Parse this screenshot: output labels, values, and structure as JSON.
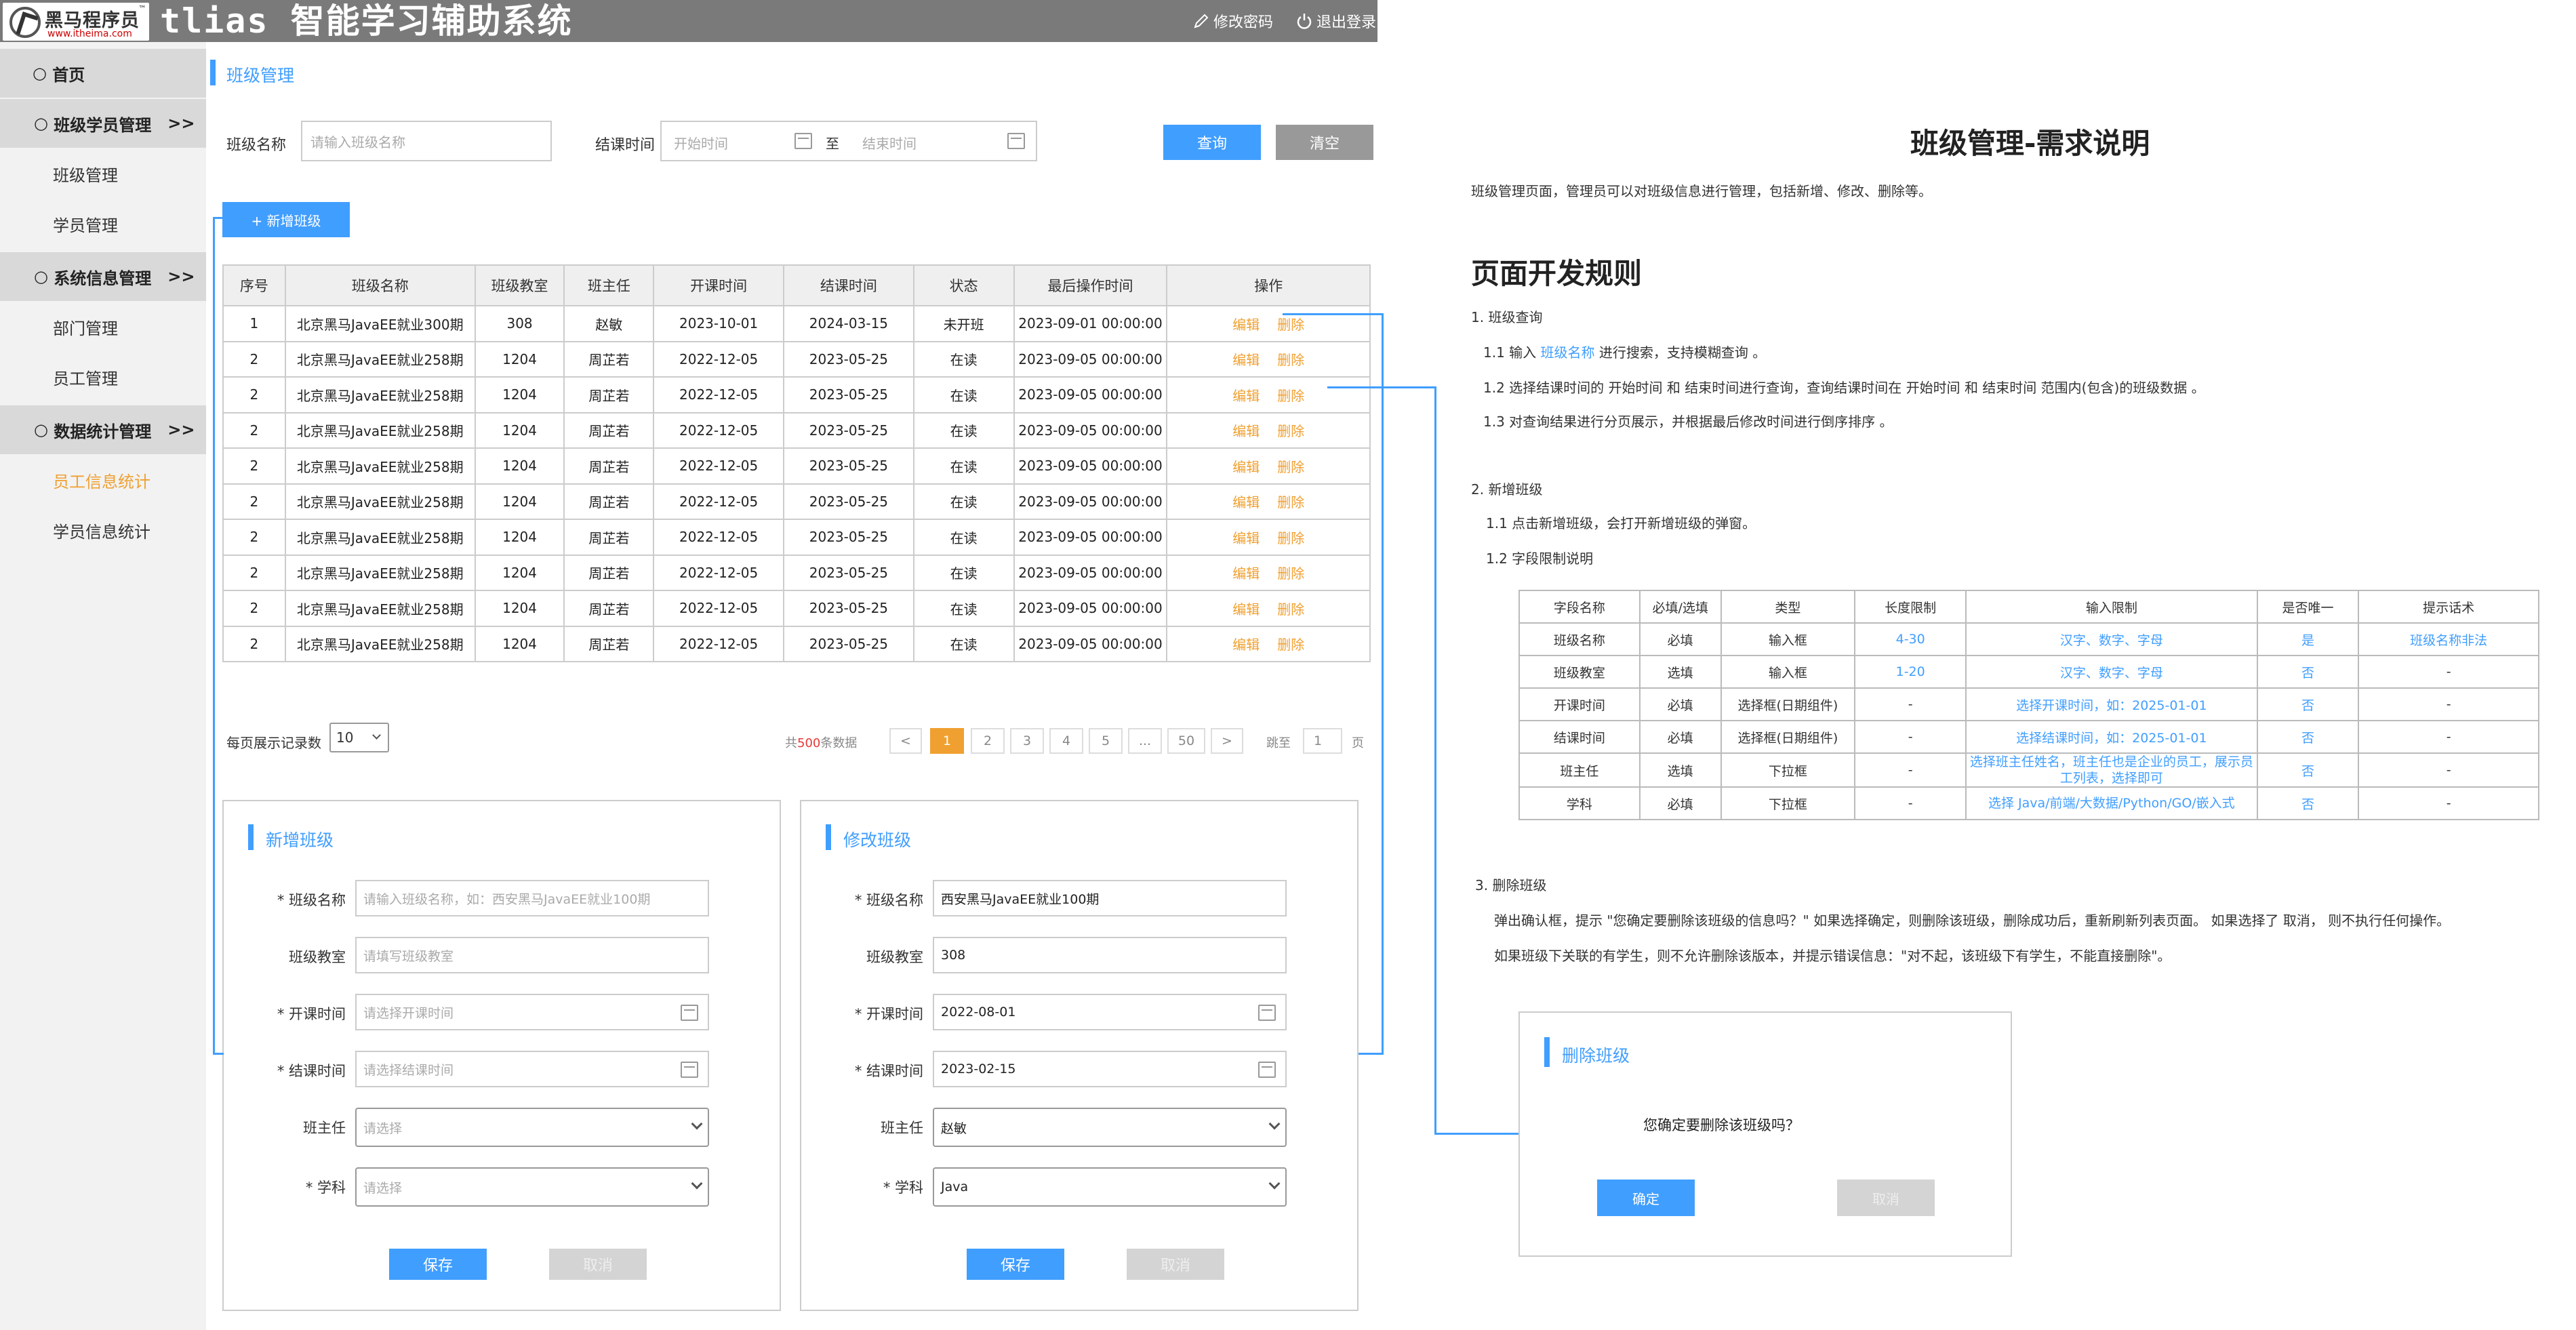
{
  "header": {
    "logo_name": "黑马程序员",
    "logo_url": "www.itheima.com",
    "app_title": "tlias 智能学习辅助系统",
    "change_password": "修改密码",
    "logout": "退出登录"
  },
  "sidebar": {
    "home": "首页",
    "groups": [
      {
        "label": "班级学员管理",
        "arrow": ">>"
      },
      {
        "label": "系统信息管理",
        "arrow": ">>"
      },
      {
        "label": "数据统计管理",
        "arrow": ">>"
      }
    ],
    "items": [
      "班级管理",
      "学员管理",
      "部门管理",
      "员工管理",
      "员工信息统计",
      "学员信息统计"
    ]
  },
  "page": {
    "breadcrumb": "班级管理",
    "search": {
      "name_label": "班级名称",
      "name_placeholder": "请输入班级名称",
      "time_label": "结课时间",
      "start_placeholder": "开始时间",
      "to": "至",
      "end_placeholder": "结束时间",
      "query_button": "查询",
      "clear_button": "清空"
    },
    "add_button": "+ 新增班级",
    "table": {
      "headers": [
        "序号",
        "班级名称",
        "班级教室",
        "班主任",
        "开课时间",
        "结课时间",
        "状态",
        "最后操作时间",
        "操作"
      ],
      "edit_label": "编辑",
      "delete_label": "删除",
      "rows": [
        [
          "1",
          "北京黑马JavaEE就业300期",
          "308",
          "赵敏",
          "2023-10-01",
          "2024-03-15",
          "未开班",
          "2023-09-01 00:00:00"
        ],
        [
          "2",
          "北京黑马JavaEE就业258期",
          "1204",
          "周芷若",
          "2022-12-05",
          "2023-05-25",
          "在读",
          "2023-09-05 00:00:00"
        ],
        [
          "2",
          "北京黑马JavaEE就业258期",
          "1204",
          "周芷若",
          "2022-12-05",
          "2023-05-25",
          "在读",
          "2023-09-05 00:00:00"
        ],
        [
          "2",
          "北京黑马JavaEE就业258期",
          "1204",
          "周芷若",
          "2022-12-05",
          "2023-05-25",
          "在读",
          "2023-09-05 00:00:00"
        ],
        [
          "2",
          "北京黑马JavaEE就业258期",
          "1204",
          "周芷若",
          "2022-12-05",
          "2023-05-25",
          "在读",
          "2023-09-05 00:00:00"
        ],
        [
          "2",
          "北京黑马JavaEE就业258期",
          "1204",
          "周芷若",
          "2022-12-05",
          "2023-05-25",
          "在读",
          "2023-09-05 00:00:00"
        ],
        [
          "2",
          "北京黑马JavaEE就业258期",
          "1204",
          "周芷若",
          "2022-12-05",
          "2023-05-25",
          "在读",
          "2023-09-05 00:00:00"
        ],
        [
          "2",
          "北京黑马JavaEE就业258期",
          "1204",
          "周芷若",
          "2022-12-05",
          "2023-05-25",
          "在读",
          "2023-09-05 00:00:00"
        ],
        [
          "2",
          "北京黑马JavaEE就业258期",
          "1204",
          "周芷若",
          "2022-12-05",
          "2023-05-25",
          "在读",
          "2023-09-05 00:00:00"
        ],
        [
          "2",
          "北京黑马JavaEE就业258期",
          "1204",
          "周芷若",
          "2022-12-05",
          "2023-05-25",
          "在读",
          "2023-09-05 00:00:00"
        ]
      ]
    },
    "pagination": {
      "page_size_label": "每页展示记录数",
      "page_size": "10",
      "total_prefix": "共",
      "total": "500",
      "total_suffix": "条数据",
      "prev": "<",
      "pages": [
        "1",
        "2",
        "3",
        "4",
        "5",
        "...",
        "50"
      ],
      "next": ">",
      "jump_label": "跳至",
      "jump_value": "1",
      "page_unit": "页"
    }
  },
  "add_form": {
    "title": "新增班级",
    "fields": [
      {
        "label": "* 班级名称",
        "placeholder": "请输入班级名称，如：西安黑马JavaEE就业100期"
      },
      {
        "label": "班级教室",
        "placeholder": "请填写班级教室"
      },
      {
        "label": "* 开课时间",
        "placeholder": "请选择开课时间"
      },
      {
        "label": "* 结课时间",
        "placeholder": "请选择结课时间"
      },
      {
        "label": "班主任",
        "placeholder": "请选择"
      },
      {
        "label": "* 学科",
        "placeholder": "请选择"
      }
    ],
    "save": "保存",
    "cancel": "取消"
  },
  "edit_form": {
    "title": "修改班级",
    "fields": [
      {
        "label": "* 班级名称",
        "value": "西安黑马JavaEE就业100期"
      },
      {
        "label": "班级教室",
        "value": "308"
      },
      {
        "label": "* 开课时间",
        "value": "2022-08-01"
      },
      {
        "label": "* 结课时间",
        "value": "2023-02-15"
      },
      {
        "label": "班主任",
        "value": "赵敏"
      },
      {
        "label": "* 学科",
        "value": "Java"
      }
    ],
    "save": "保存",
    "cancel": "取消"
  },
  "doc": {
    "title": "班级管理-需求说明",
    "intro": "班级管理页面，管理员可以对班级信息进行管理，包括新增、修改、删除等。",
    "rules_title": "页面开发规则",
    "s1": "1. 班级查询",
    "s1_1a": "1.1 输入 ",
    "s1_1b": "班级名称",
    "s1_1c": " 进行搜索，支持模糊查询 。",
    "s1_2": "1.2 选择结课时间的 开始时间 和 结束时间进行查询，查询结课时间在 开始时间 和 结束时间 范围内(包含)的班级数据 。",
    "s1_3": "1.3 对查询结果进行分页展示，并根据最后修改时间进行倒序排序 。",
    "s2": "2. 新增班级",
    "s2_1": "1.1 点击新增班级，会打开新增班级的弹窗。",
    "s2_2": "1.2 字段限制说明",
    "field_table": {
      "headers": [
        "字段名称",
        "必填/选填",
        "类型",
        "长度限制",
        "输入限制",
        "是否唯一",
        "提示话术"
      ],
      "rows": [
        [
          "班级名称",
          "必填",
          "输入框",
          "4-30",
          "汉字、数字、字母",
          "是",
          "班级名称非法"
        ],
        [
          "班级教室",
          "选填",
          "输入框",
          "1-20",
          "汉字、数字、字母",
          "否",
          "-"
        ],
        [
          "开课时间",
          "必填",
          "选择框(日期组件)",
          "-",
          "选择开课时间，如：2025-01-01",
          "否",
          "-"
        ],
        [
          "结课时间",
          "必填",
          "选择框(日期组件)",
          "-",
          "选择结课时间，如：2025-01-01",
          "否",
          "-"
        ],
        [
          "班主任",
          "选填",
          "下拉框",
          "-",
          "选择班主任姓名，班主任也是企业的员工，展示员工列表，选择即可",
          "否",
          "-"
        ],
        [
          "学科",
          "必填",
          "下拉框",
          "-",
          "选择 Java/前端/大数据/Python/GO/嵌入式",
          "否",
          "-"
        ]
      ]
    },
    "s3": "3.  删除班级",
    "s3_1": "弹出确认框，提示 \"您确定要删除该班级的信息吗？\" 如果选择确定，则删除该班级，删除成功后，重新刷新列表页面。 如果选择了 取消， 则不执行任何操作。",
    "s3_2": "如果班级下关联的有学生，则不允许删除该版本，并提示错误信息：\"对不起，该班级下有学生，不能直接删除\"。"
  },
  "delete_dialog": {
    "title": "删除班级",
    "message": "您确定要删除该班级吗？",
    "confirm": "确定",
    "cancel": "取消"
  },
  "colors": {
    "primary": "#409eff",
    "accent": "#f0a030",
    "header_bg": "#7a7a7a",
    "sidebar_bg": "#f2f2f2"
  }
}
